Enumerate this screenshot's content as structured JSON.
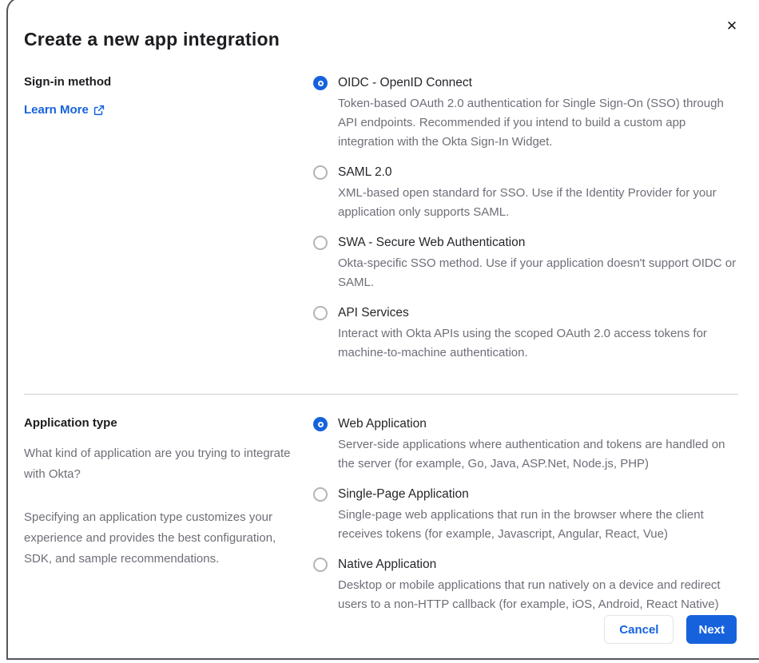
{
  "modal": {
    "title": "Create a new app integration",
    "close_icon": "✕"
  },
  "colors": {
    "accent_blue": "#1662dd",
    "text_dark": "#1d1d21",
    "text_gray": "#6e6e78",
    "divider": "#cfcfd4"
  },
  "signin_section": {
    "label": "Sign-in method",
    "learn_more_label": "Learn More",
    "options": [
      {
        "label": "OIDC - OpenID Connect",
        "description": "Token-based OAuth 2.0 authentication for Single Sign-On (SSO) through API endpoints. Recommended if you intend to build a custom app integration with the Okta Sign-In Widget.",
        "selected": true
      },
      {
        "label": "SAML 2.0",
        "description": "XML-based open standard for SSO. Use if the Identity Provider for your application only supports SAML.",
        "selected": false
      },
      {
        "label": "SWA - Secure Web Authentication",
        "description": "Okta-specific SSO method. Use if your application doesn't support OIDC or SAML.",
        "selected": false
      },
      {
        "label": "API Services",
        "description": "Interact with Okta APIs using the scoped OAuth 2.0 access tokens for machine-to-machine authentication.",
        "selected": false
      }
    ]
  },
  "apptype_section": {
    "label": "Application type",
    "description1": "What kind of application are you trying to integrate with Okta?",
    "description2": "Specifying an application type customizes your experience and provides the best configuration, SDK, and sample recommendations.",
    "options": [
      {
        "label": "Web Application",
        "description": "Server-side applications where authentication and tokens are handled on the server (for example, Go, Java, ASP.Net, Node.js, PHP)",
        "selected": true
      },
      {
        "label": "Single-Page Application",
        "description": "Single-page web applications that run in the browser where the client receives tokens (for example, Javascript, Angular, React, Vue)",
        "selected": false
      },
      {
        "label": "Native Application",
        "description": "Desktop or mobile applications that run natively on a device and redirect users to a non-HTTP callback (for example, iOS, Android, React Native)",
        "selected": false
      }
    ]
  },
  "footer": {
    "cancel_label": "Cancel",
    "next_label": "Next"
  }
}
